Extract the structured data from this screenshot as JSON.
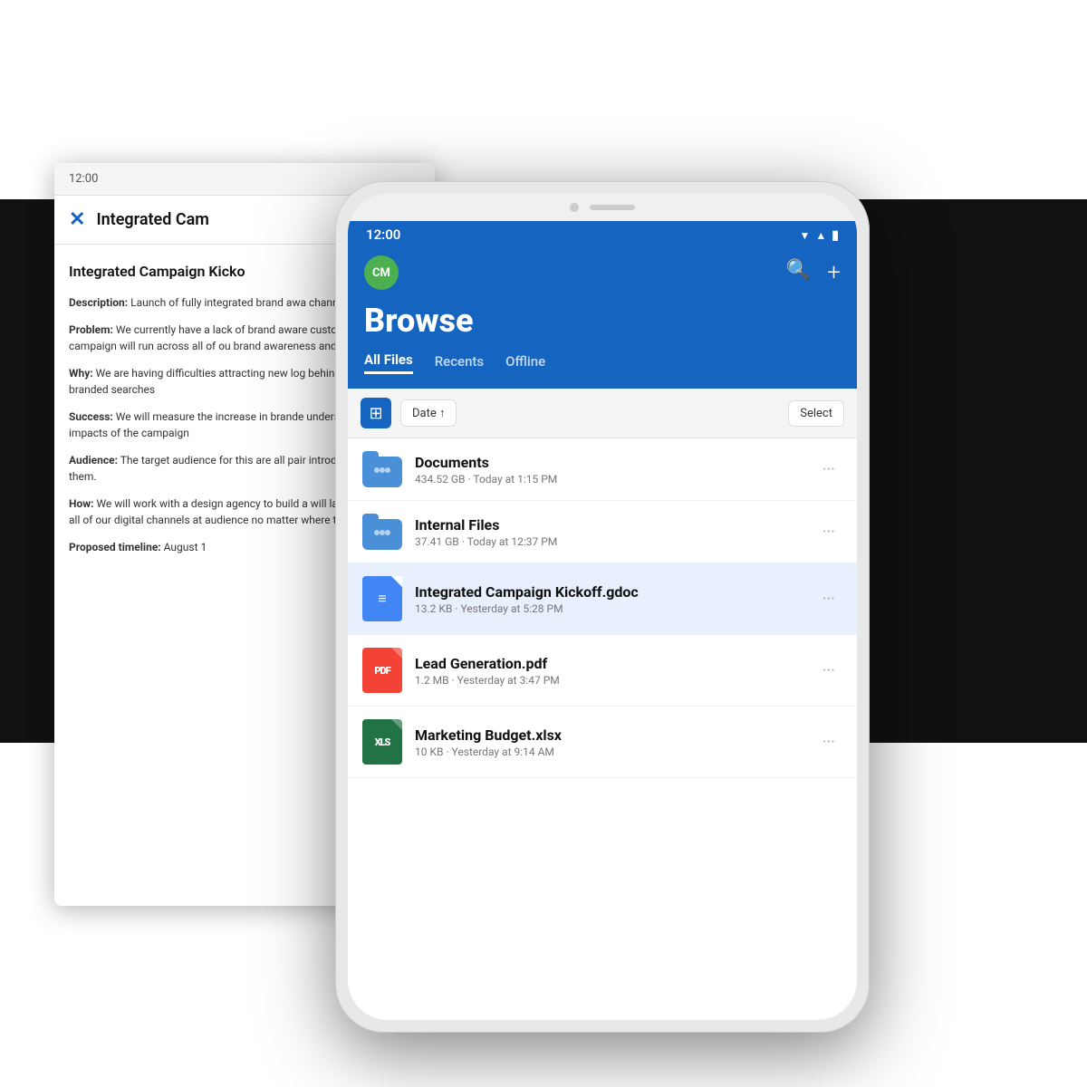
{
  "background": {
    "status_time": "12:00"
  },
  "bg_document": {
    "status_time": "12:00",
    "close_label": "✕",
    "title": "Integrated Cam",
    "main_title": "Integrated Campaign Kicko",
    "sections": [
      {
        "label": "Description:",
        "text": " Launch of fully integrated brand awa channels."
      },
      {
        "label": "Problem:",
        "text": " We currently have a lack of brand aware customers. This campaign will run across all of ou brand awareness and brand recall"
      },
      {
        "label": "Why:",
        "text": " We are having difficulties attracting new log behind our non-branded searches"
      },
      {
        "label": "Success:",
        "text": " We will measure the increase in brande understand the full impacts of the campaign"
      },
      {
        "label": "Audience:",
        "text": " The target audience for this are all pair introduce our brand to them."
      },
      {
        "label": "How:",
        "text": " We will work with a design agency to build a will launch this across all of our digital channels at audience no matter where they are"
      },
      {
        "label": "Proposed timeline:",
        "text": " August 1"
      }
    ]
  },
  "phone": {
    "status_time": "12:00",
    "avatar_initials": "CM",
    "avatar_color": "#4CAF50",
    "browse_title": "Browse",
    "tabs": [
      {
        "label": "All Files",
        "active": true
      },
      {
        "label": "Recents",
        "active": false
      },
      {
        "label": "Offline",
        "active": false
      }
    ],
    "sort_label": "Date ↑",
    "select_label": "Select",
    "files": [
      {
        "name": "Documents",
        "meta": "434.52 GB · Today at 1:15 PM",
        "type": "folder",
        "highlighted": false
      },
      {
        "name": "Internal Files",
        "meta": "37.41 GB · Today at 12:37 PM",
        "type": "folder",
        "highlighted": false
      },
      {
        "name": "Integrated Campaign Kickoff.gdoc",
        "meta": "13.2 KB · Yesterday at 5:28 PM",
        "type": "gdoc",
        "highlighted": true
      },
      {
        "name": "Lead Generation.pdf",
        "meta": "1.2 MB · Yesterday at 3:47 PM",
        "type": "pdf",
        "highlighted": false
      },
      {
        "name": "Marketing Budget.xlsx",
        "meta": "10 KB · Yesterday at 9:14 AM",
        "type": "xlsx",
        "highlighted": false
      }
    ]
  }
}
